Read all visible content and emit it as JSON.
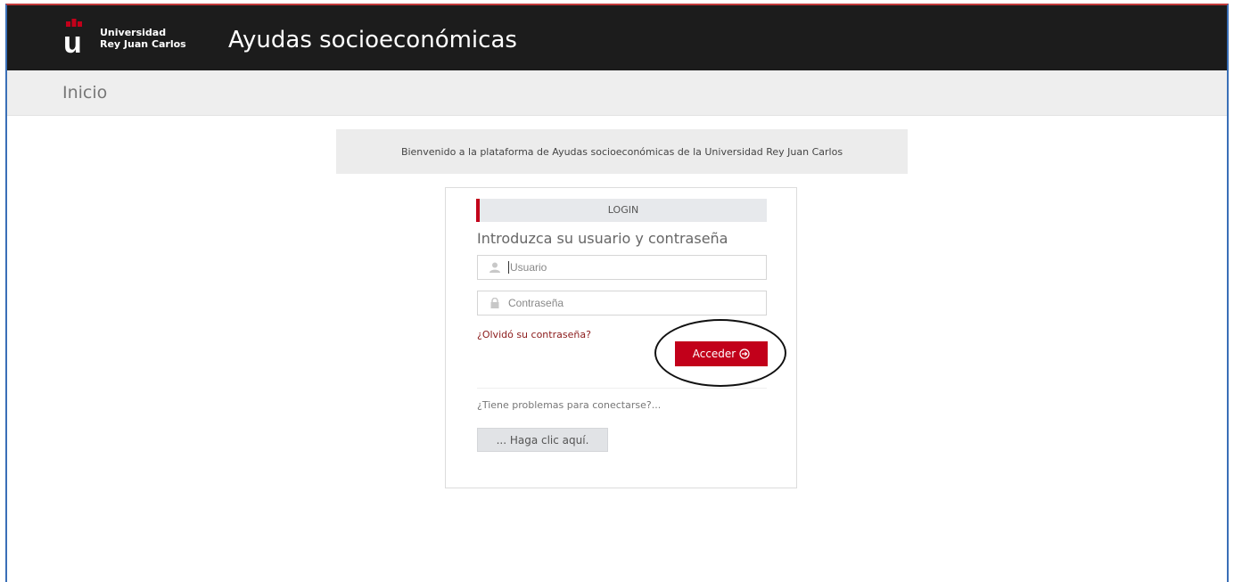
{
  "header": {
    "logo_line1": "Universidad",
    "logo_line2": "Rey Juan Carlos",
    "app_title": "Ayudas socioeconómicas",
    "bg_color": "#1c1c1c"
  },
  "breadcrumb": {
    "label": "Inicio"
  },
  "welcome": {
    "text": "Bienvenido a la plataforma de Ayudas socioeconómicas de la Universidad Rey Juan Carlos"
  },
  "login": {
    "header": "LOGIN",
    "subtitle": "Introduzca su usuario y contraseña",
    "username": {
      "placeholder": "Usuario",
      "value": "",
      "icon": "user-icon"
    },
    "password": {
      "placeholder": "Contraseña",
      "value": "",
      "icon": "lock-icon"
    },
    "forgot_link": "¿Olvidó su contraseña?",
    "submit_label": "Acceder",
    "submit_icon": "arrow-circle-right-icon",
    "problems_text": "¿Tiene problemas para conectarse?...",
    "help_button": "... Haga clic aquí.",
    "accent_color": "#c2001a"
  },
  "annotation": {
    "shape": "ellipse",
    "target": "submit_button",
    "color": "#111111"
  }
}
